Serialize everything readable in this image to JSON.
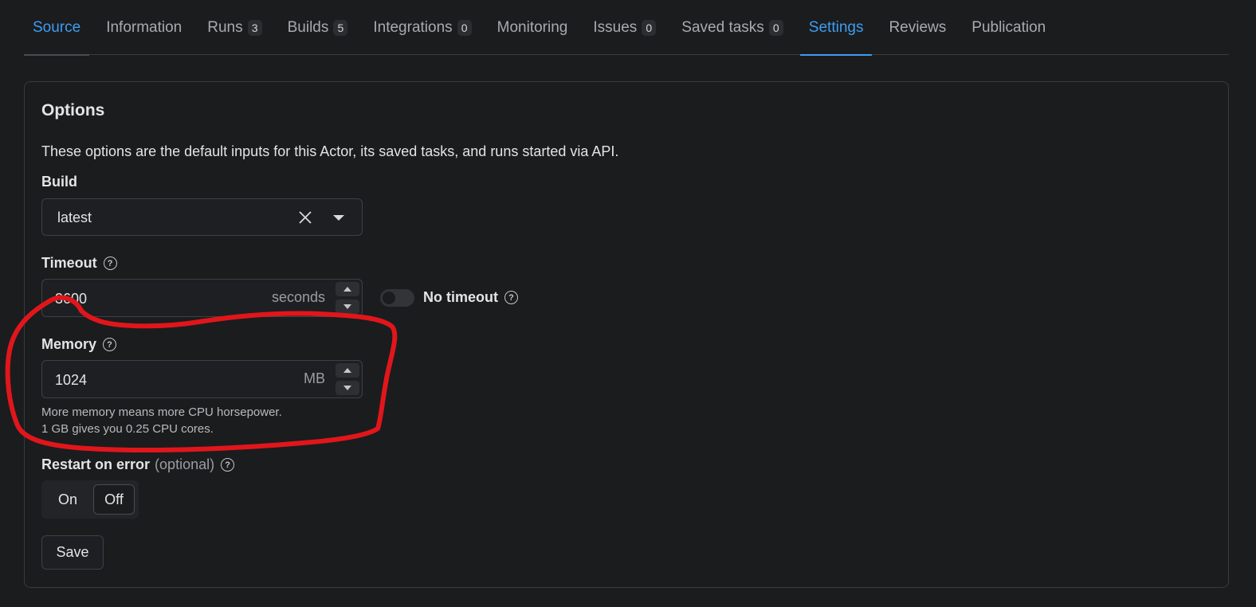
{
  "tabs": [
    {
      "label": "Source",
      "count": null,
      "active": true
    },
    {
      "label": "Information",
      "count": null
    },
    {
      "label": "Runs",
      "count": "3"
    },
    {
      "label": "Builds",
      "count": "5"
    },
    {
      "label": "Integrations",
      "count": "0"
    },
    {
      "label": "Monitoring",
      "count": null
    },
    {
      "label": "Issues",
      "count": "0"
    },
    {
      "label": "Saved tasks",
      "count": "0"
    },
    {
      "label": "Settings",
      "count": null,
      "active": true
    },
    {
      "label": "Reviews",
      "count": null
    },
    {
      "label": "Publication",
      "count": null
    }
  ],
  "options": {
    "title": "Options",
    "description": "These options are the default inputs for this Actor, its saved tasks, and runs started via API.",
    "build": {
      "label": "Build",
      "value": "latest"
    },
    "timeout": {
      "label": "Timeout",
      "value": "3600",
      "unit": "seconds",
      "no_timeout_label": "No timeout"
    },
    "memory": {
      "label": "Memory",
      "value": "1024",
      "unit": "MB",
      "hint_line1": "More memory means more CPU horsepower.",
      "hint_line2": "1 GB gives you 0.25 CPU cores."
    },
    "restart": {
      "label": "Restart on error",
      "optional": "(optional)",
      "on_label": "On",
      "off_label": "Off",
      "selected": "Off"
    },
    "save_label": "Save"
  },
  "icons": {
    "help": "question-circle-icon",
    "clear": "close-icon",
    "caret": "chevron-down-icon"
  },
  "colors": {
    "accent": "#3d9df2",
    "annotation": "#e0161b"
  }
}
